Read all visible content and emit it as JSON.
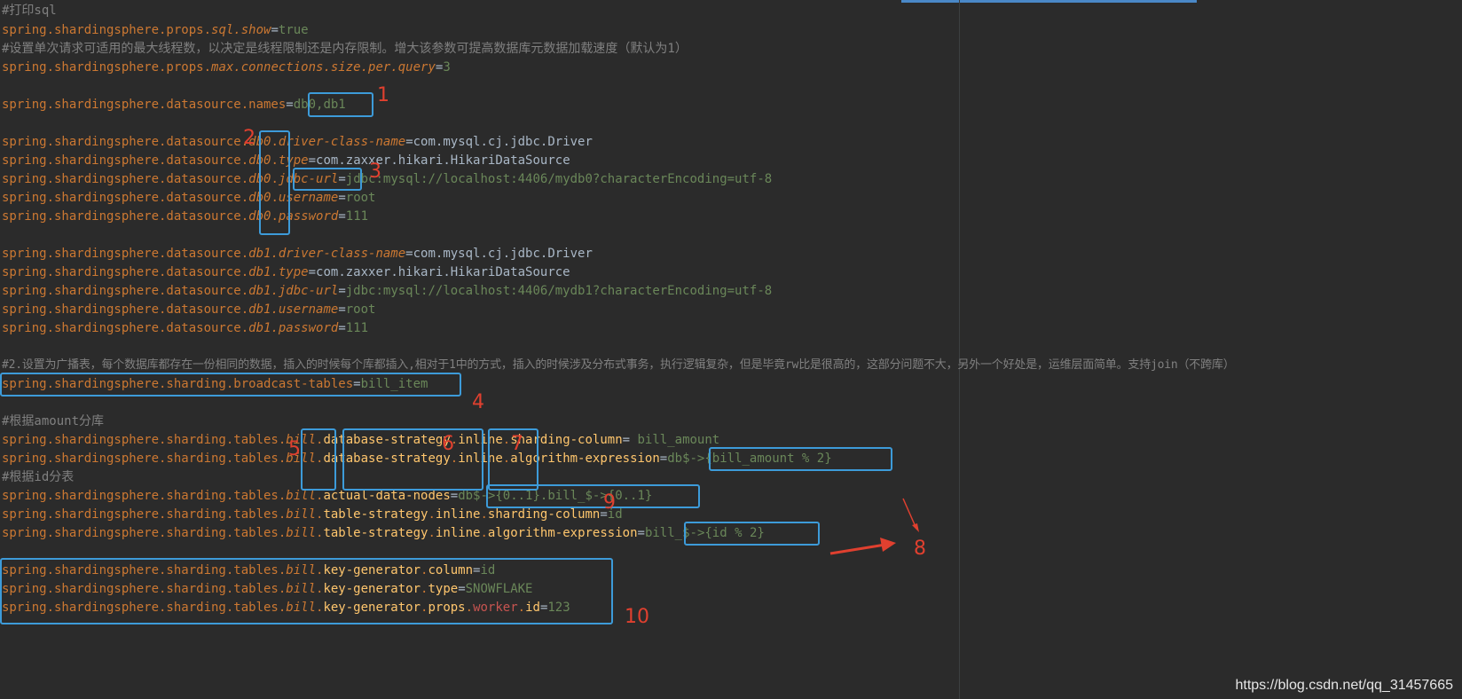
{
  "lines": [
    {
      "comment": "#打印sql"
    },
    {
      "key": "spring.shardingsphere.props.sql.show",
      "parts": [
        "spring.shardingsphere.props.",
        "sql.show"
      ],
      "value": "true"
    },
    {
      "comment": "#设置单次请求可适用的最大线程数，以决定是线程限制还是内存限制。增大该参数可提高数据库元数据加载速度（默认为1）"
    },
    {
      "parts": [
        "spring.shardingsphere.props.",
        "max.connections.size.per.query"
      ],
      "value": "3"
    },
    {
      "parts": [
        "spring.shardingsphere.datasource.names"
      ],
      "value": "db0,db1"
    },
    {
      "parts": [
        "spring.shardingsphere.datasource.",
        "db0",
        ".",
        "driver-class-name"
      ],
      "value": "com.mysql.cj.jdbc.Driver"
    },
    {
      "parts": [
        "spring.shardingsphere.datasource.",
        "db0",
        ".",
        "type"
      ],
      "value": "com.zaxxer.hikari.HikariDataSource"
    },
    {
      "parts": [
        "spring.shardingsphere.datasource.",
        "db0",
        ".",
        "jdbc-url"
      ],
      "value": "jdbc:mysql://localhost:4406/mydb0?characterEncoding=utf-8"
    },
    {
      "parts": [
        "spring.shardingsphere.datasource.",
        "db0",
        ".",
        "username"
      ],
      "value": "root"
    },
    {
      "parts": [
        "spring.shardingsphere.datasource.",
        "db0",
        ".",
        "password"
      ],
      "value": "111"
    },
    {
      "parts": [
        "spring.shardingsphere.datasource.",
        "db1.driver-class-name"
      ],
      "value": "com.mysql.cj.jdbc.Driver"
    },
    {
      "parts": [
        "spring.shardingsphere.datasource.",
        "db1.type"
      ],
      "value": "com.zaxxer.hikari.HikariDataSource"
    },
    {
      "parts": [
        "spring.shardingsphere.datasource.",
        "db1.jdbc-url"
      ],
      "value": "jdbc:mysql://localhost:4406/mydb1?characterEncoding=utf-8"
    },
    {
      "parts": [
        "spring.shardingsphere.datasource.",
        "db1.username"
      ],
      "value": "root"
    },
    {
      "parts": [
        "spring.shardingsphere.datasource.",
        "db1.password"
      ],
      "value": "111"
    },
    {
      "comment": "#2.设置为广播表，每个数据库都存在一份相同的数据，插入的时候每个库都插入,相对于1中的方式，插入的时候涉及分布式事务，执行逻辑复杂，但是毕竟rw比是很高的，这部分问题不大，另外一个好处是，运维层面简单。支持join（不跨库）"
    },
    {
      "parts": [
        "spring.shardingsphere.sharding.broadcast-tables"
      ],
      "value": "bill_item"
    },
    {
      "comment": "#根据amount分库"
    },
    {
      "parts": [
        "spring.shardingsphere.sharding.tables.",
        "bill",
        ".",
        "database-strategy",
        ".",
        "inline",
        ".",
        "sharding-column"
      ],
      "value": " bill_amount"
    },
    {
      "parts": [
        "spring.shardingsphere.sharding.tables.",
        "bill",
        ".",
        "database-strategy",
        ".",
        "inline",
        ".",
        "algorithm-expression"
      ],
      "value": "db$->{bill_amount % 2}"
    },
    {
      "comment": "#根据id分表"
    },
    {
      "parts": [
        "spring.shardingsphere.sharding.tables.",
        "bill",
        ".",
        "actual-data-nodes"
      ],
      "value": "db$->{0..1}.bill_$->{0..1}"
    },
    {
      "parts": [
        "spring.shardingsphere.sharding.tables.",
        "bill",
        ".",
        "table-strategy",
        ".",
        "inline",
        ".",
        "sharding-column"
      ],
      "value": "id"
    },
    {
      "parts": [
        "spring.shardingsphere.sharding.tables.",
        "bill",
        ".",
        "table-strategy",
        ".",
        "inline",
        ".",
        "algorithm-expression"
      ],
      "value": "bill_$->{id % 2}"
    },
    {
      "parts": [
        "spring.shardingsphere.sharding.tables.",
        "bill",
        ".",
        "key-generator",
        ".",
        "column"
      ],
      "value": "id"
    },
    {
      "parts": [
        "spring.shardingsphere.sharding.tables.",
        "bill",
        ".",
        "key-generator",
        ".",
        "type"
      ],
      "value": "SNOWFLAKE"
    },
    {
      "parts": [
        "spring.shardingsphere.sharding.tables.",
        "bill",
        ".",
        "key-generator",
        ".",
        "props",
        ".",
        "worker",
        ".",
        "id"
      ],
      "value": "123"
    }
  ],
  "annotations": [
    "1",
    "2",
    "3",
    "4",
    "5",
    "6",
    "7",
    "8",
    "9",
    "10"
  ],
  "watermark": "https://blog.csdn.net/qq_31457665",
  "colors": {
    "background": "#2b2b2b",
    "key": "#cc7832",
    "value": "#6a8759",
    "comment": "#808080",
    "box": "#3d9bd9",
    "annotation": "#e0402f"
  }
}
